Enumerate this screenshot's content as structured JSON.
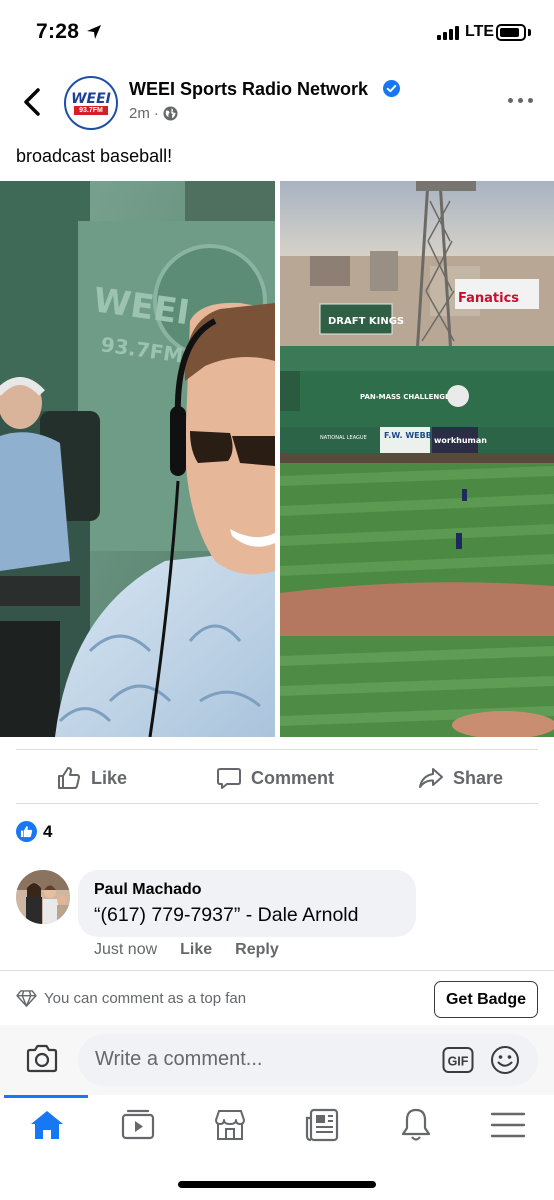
{
  "status_bar": {
    "time": "7:28",
    "network": "LTE",
    "battery_level": 0.85
  },
  "post": {
    "page_name": "WEEI Sports Radio Network",
    "page_logo_text": "WEEI",
    "page_logo_sub": "93.7FM",
    "time_ago": "2m",
    "privacy_separator": "·",
    "text": "broadcast baseball!",
    "photos": {
      "left_signage": [
        "WEEI",
        "93.7FM"
      ],
      "right_signage": [
        "DRAFT KINGS",
        "Fanatics",
        "PAN-MASS CHALLENGE",
        "F.W. WEBB",
        "workhuman",
        "NATIONAL LEAGUE"
      ]
    }
  },
  "actions": {
    "like_label": "Like",
    "comment_label": "Comment",
    "share_label": "Share"
  },
  "reactions": {
    "count": "4"
  },
  "comment": {
    "author": "Paul Machado",
    "text": "“(617) 779-7937” - Dale Arnold",
    "time": "Just now",
    "like_label": "Like",
    "reply_label": "Reply"
  },
  "top_fan": {
    "message": "You can comment as a top fan",
    "button_label": "Get Badge"
  },
  "composer": {
    "placeholder": "Write a comment...",
    "gif_label": "GIF"
  },
  "bottom_nav": {
    "items": [
      "home-icon",
      "watch-icon",
      "marketplace-icon",
      "news-icon",
      "notifications-icon",
      "menu-icon"
    ],
    "active": "home-icon"
  },
  "colors": {
    "accent": "#1877f2",
    "verified": "#1877f2",
    "secondary_text": "#65676b",
    "bubble": "#f0f2f5"
  }
}
